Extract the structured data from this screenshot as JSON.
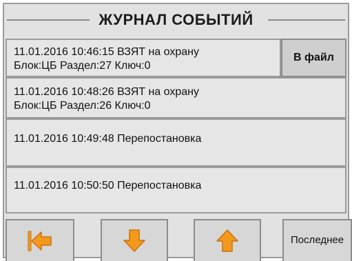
{
  "header": {
    "title": "ЖУРНАЛ СОБЫТИЙ"
  },
  "events": [
    {
      "line1": "11.01.2016 10:46:15 ВЗЯТ на охрану",
      "line2": "Блок:ЦБ Раздел:27 Ключ:0"
    },
    {
      "line1": "11.01.2016 10:48:26 ВЗЯТ на охрану",
      "line2": "Блок:ЦБ Раздел:26 Ключ:0"
    },
    {
      "line1": "11.01.2016 10:49:48 Перепостановка",
      "line2": ""
    },
    {
      "line1": "11.01.2016 10:50:50 Перепостановка",
      "line2": ""
    }
  ],
  "buttons": {
    "to_file": "В файл",
    "last": "Последнее"
  },
  "icons": {
    "first": "skip-to-first-icon",
    "down": "arrow-down-icon",
    "up": "arrow-up-icon"
  },
  "colors": {
    "arrow_fill": "#f39a1d",
    "arrow_stroke": "#c9700a",
    "panel": "#e2e2e2",
    "border": "#9a9a9a"
  }
}
